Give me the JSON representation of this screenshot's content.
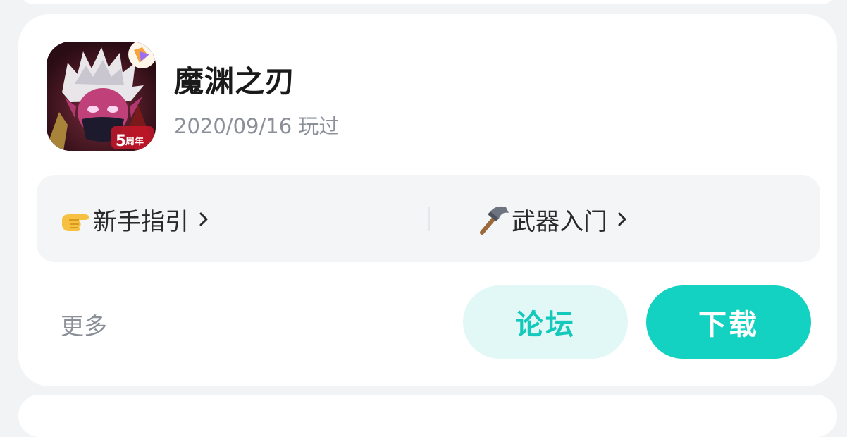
{
  "game": {
    "name": "魔渊之刃",
    "played": "2020/09/16 玩过",
    "icon": "game-cover-icon",
    "badge_text": "5周年"
  },
  "guides": [
    {
      "label": "新手指引",
      "icon": "pointing-hand-emoji"
    },
    {
      "label": "武器入门",
      "icon": "hammer-emoji"
    }
  ],
  "actions": {
    "more_label": "更多",
    "forum_label": "论坛",
    "download_label": "下载"
  },
  "colors": {
    "accent": "#13d2c1",
    "forum_bg": "#e2f8f6",
    "muted_text": "#8a8f98"
  }
}
